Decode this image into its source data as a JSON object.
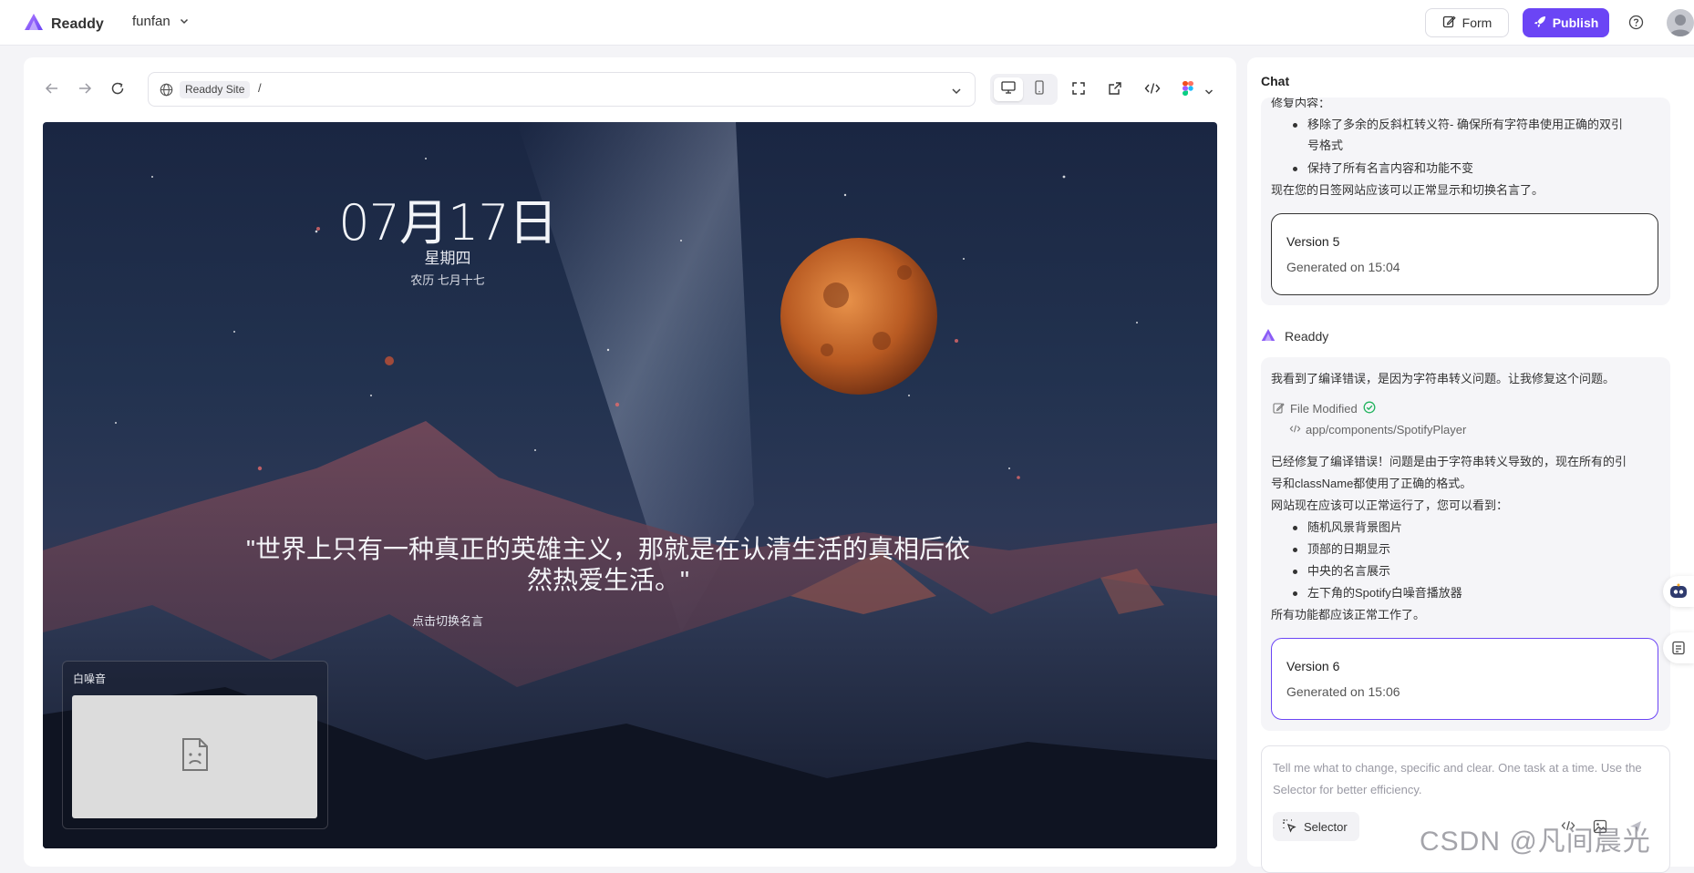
{
  "app": {
    "name": "Readdy",
    "project": "funfan"
  },
  "header": {
    "form_label": "Form",
    "publish_label": "Publish"
  },
  "browser": {
    "site_label": "Readdy Site",
    "path": "/"
  },
  "site": {
    "date": "07月17日",
    "weekday": "星期四",
    "lunar": "农历 七月十七",
    "quote": "\"世界上只有一种真正的英雄主义，那就是在认清生活的真相后依然热爱生活。\"",
    "quote_hint": "点击切换名言",
    "player_title": "白噪音"
  },
  "chat": {
    "title": "Chat",
    "prev_message": {
      "partial_line": "修复内容：",
      "bullets": [
        "移除了多余的反斜杠转义符- 确保所有字符串使用正确的双引",
        "号格式",
        "保持了所有名言内容和功能不变"
      ],
      "closing": "现在您的日签网站应该可以正常显示和切换名言了。",
      "version": {
        "title": "Version 5",
        "generated": "Generated on 15:04"
      }
    },
    "author": "Readdy",
    "message": {
      "intro": "我看到了编译错误，是因为字符串转义问题。让我修复这个问题。",
      "file_modified": "File Modified",
      "file_path": "app/components/SpotifyPlayer",
      "body_line1": "已经修复了编译错误！问题是由于字符串转义导致的，现在所有的引",
      "body_line2": "号和className都使用了正确的格式。",
      "body_line3": "网站现在应该可以正常运行了，您可以看到：",
      "bullets": [
        "随机风景背景图片",
        "顶部的日期显示",
        "中央的名言展示",
        "左下角的Spotify白噪音播放器"
      ],
      "closing": "所有功能都应该正常工作了。",
      "version": {
        "title": "Version 6",
        "generated": "Generated on 15:06"
      }
    },
    "input": {
      "placeholder": "Tell me what to change, specific and clear. One task at a time. Use the Selector for better efficiency.",
      "selector_label": "Selector"
    }
  },
  "watermark": "CSDN @凡间晨光",
  "colors": {
    "accent": "#6b45f5",
    "version_active_border": "#6b45f5"
  }
}
